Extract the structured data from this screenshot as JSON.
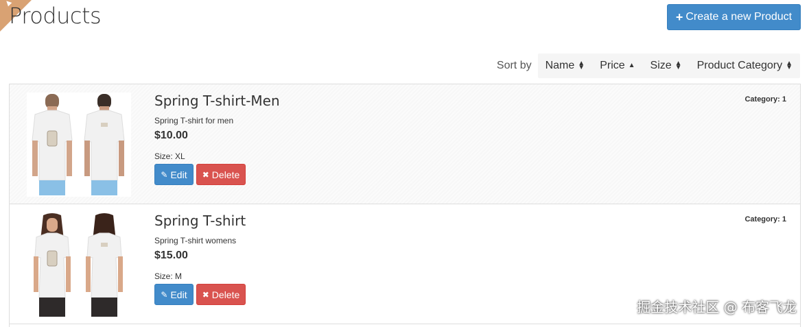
{
  "header": {
    "title": "Products",
    "create_button_label": "Create a new Product"
  },
  "sort": {
    "label": "Sort by",
    "options": [
      {
        "label": "Name",
        "icon": "sort-icon"
      },
      {
        "label": "Price",
        "icon": "sort-asc-icon"
      },
      {
        "label": "Size",
        "icon": "sort-icon"
      },
      {
        "label": "Product Category",
        "icon": "sort-icon"
      }
    ]
  },
  "products": [
    {
      "name": "Spring T-shirt-Men",
      "description": "Spring T-shirt for men",
      "price": "$10.00",
      "size": "Size: XL",
      "category": "Category: 1",
      "edit_label": "Edit",
      "delete_label": "Delete"
    },
    {
      "name": "Spring T-shirt",
      "description": "Spring T-shirt womens",
      "price": "$15.00",
      "size": "Size: M",
      "category": "Category: 1",
      "edit_label": "Edit",
      "delete_label": "Delete"
    }
  ],
  "watermark": "掘金技术社区 @ 布客飞龙",
  "colors": {
    "primary": "#428bca",
    "danger": "#d9534f",
    "ribbon": "#d9a273"
  }
}
